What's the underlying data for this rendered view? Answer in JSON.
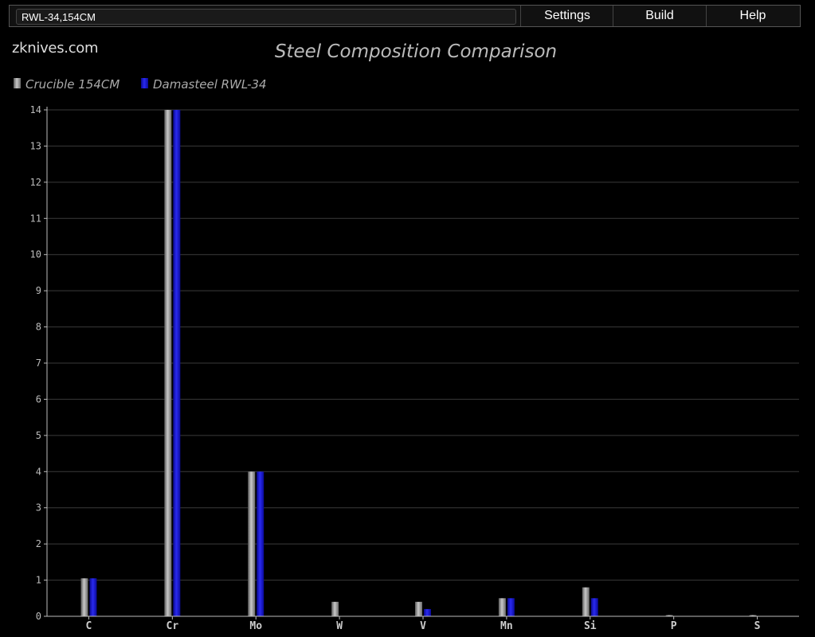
{
  "topbar": {
    "search_value": "RWL-34,154CM",
    "menu": [
      "Settings",
      "Build",
      "Help"
    ]
  },
  "logo": "zknives.com",
  "colors": {
    "series_1": "#8a8a8a",
    "series_2": "#1010c8",
    "grid": "#3a3a3a",
    "axis": "#bbbbbb"
  },
  "chart_data": {
    "type": "bar",
    "title": "Steel Composition Comparison",
    "xlabel": "",
    "ylabel": "",
    "categories": [
      "C",
      "Cr",
      "Mo",
      "W",
      "V",
      "Mn",
      "Si",
      "P",
      "S"
    ],
    "series": [
      {
        "name": "Crucible 154CM",
        "values": [
          1.05,
          14,
          4,
          0.4,
          0.4,
          0.5,
          0.8,
          0.03,
          0.03
        ]
      },
      {
        "name": "Damasteel RWL-34",
        "values": [
          1.05,
          14,
          4,
          0,
          0.2,
          0.5,
          0.5,
          0,
          0
        ]
      }
    ],
    "ylim": [
      0,
      14
    ],
    "yticks": [
      0,
      1,
      2,
      3,
      4,
      5,
      6,
      7,
      8,
      9,
      10,
      11,
      12,
      13,
      14
    ],
    "grid": true,
    "legend_position": "top-left"
  }
}
